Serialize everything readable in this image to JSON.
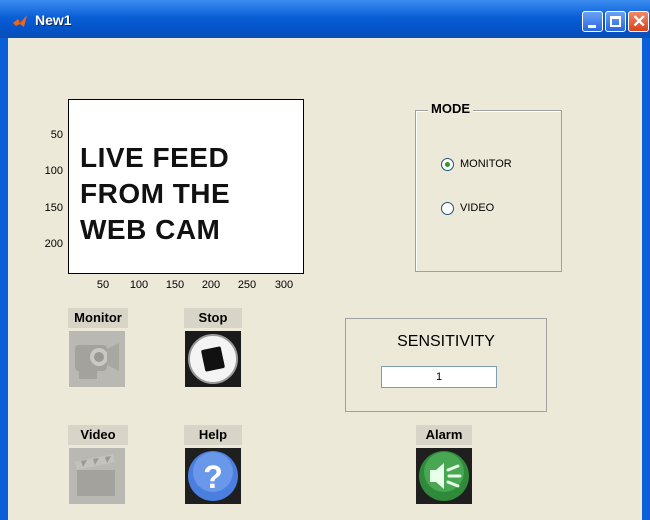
{
  "window": {
    "title": "New1"
  },
  "axes": {
    "feed_lines": [
      "LIVE FEED",
      "FROM THE",
      "WEB CAM"
    ],
    "yticks": [
      "50",
      "100",
      "150",
      "200"
    ],
    "xticks": [
      "50",
      "100",
      "150",
      "200",
      "250",
      "300"
    ]
  },
  "mode": {
    "title": "MODE",
    "options": [
      {
        "label": "MONITOR",
        "selected": true
      },
      {
        "label": "VIDEO",
        "selected": false
      }
    ]
  },
  "sensitivity": {
    "label": "SENSITIVITY",
    "value": "1"
  },
  "buttons": {
    "monitor": {
      "label": "Monitor",
      "icon": "camcorder-icon",
      "enabled": false
    },
    "stop": {
      "label": "Stop",
      "icon": "stop-icon",
      "enabled": true
    },
    "video": {
      "label": "Video",
      "icon": "clapperboard-icon",
      "enabled": false
    },
    "help": {
      "label": "Help",
      "icon": "help-icon",
      "enabled": true
    },
    "alarm": {
      "label": "Alarm",
      "icon": "speaker-icon",
      "enabled": true
    }
  }
}
